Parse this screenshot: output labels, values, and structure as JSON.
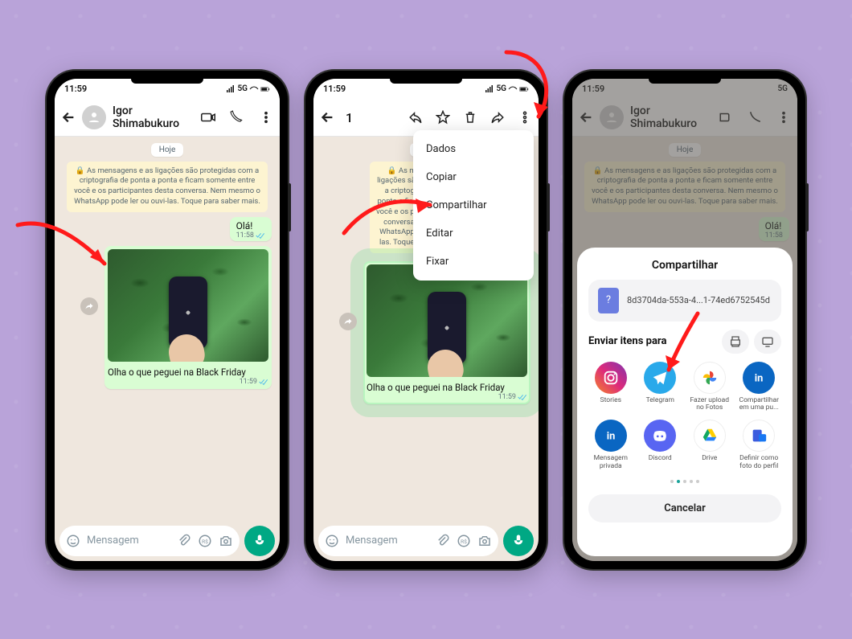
{
  "status": {
    "time": "11:59",
    "network": "5G"
  },
  "contact": {
    "name": "Igor Shimabukuro"
  },
  "chat": {
    "date_label": "Hoje",
    "encryption_notice": "🔒 As mensagens e as ligações são protegidas com a criptografia de ponta a ponta e ficam somente entre você e os participantes desta conversa. Nem mesmo o WhatsApp pode ler ou ouvi-las. Toque para saber mais.",
    "greeting": {
      "text": "Olá!",
      "time": "11:58"
    },
    "photo_msg": {
      "caption": "Olha o que peguei na Black Friday",
      "time": "11:59"
    }
  },
  "composer": {
    "placeholder": "Mensagem"
  },
  "selection": {
    "count": "1"
  },
  "menu": {
    "items": [
      "Dados",
      "Copiar",
      "Compartilhar",
      "Editar",
      "Fixar"
    ]
  },
  "share": {
    "title": "Compartilhar",
    "filename": "8d3704da-553a-4...1-74ed6752545d",
    "send_to": "Enviar itens para",
    "apps": [
      {
        "label": "Stories",
        "color": "linear-gradient(45deg,#f58529,#dd2a7b,#8134af)",
        "icon": "instagram"
      },
      {
        "label": "Telegram",
        "color": "#29a9ea",
        "icon": "telegram"
      },
      {
        "label": "Fazer upload no Fotos",
        "color": "#fff",
        "icon": "photos"
      },
      {
        "label": "Compartilhar em uma pu...",
        "color": "#0a66c2",
        "icon": "linkedin"
      },
      {
        "label": "Mensagem privada",
        "color": "#0a66c2",
        "icon": "linkedin"
      },
      {
        "label": "Discord",
        "color": "#5865f2",
        "icon": "discord"
      },
      {
        "label": "Drive",
        "color": "#fff",
        "icon": "drive"
      },
      {
        "label": "Definir como foto do perfil",
        "color": "#fff",
        "icon": "profile"
      }
    ],
    "cancel": "Cancelar"
  }
}
